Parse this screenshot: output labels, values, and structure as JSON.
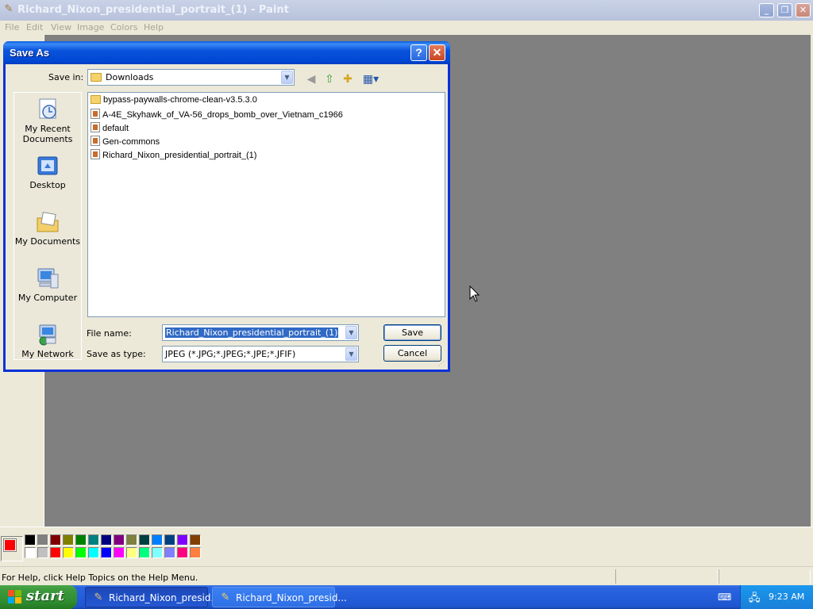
{
  "app": {
    "title": "Richard_Nixon_presidential_portrait_(1) - Paint",
    "menu": [
      "File",
      "Edit",
      "View",
      "Image",
      "Colors",
      "Help"
    ]
  },
  "dialog": {
    "title": "Save As",
    "save_in_label": "Save in:",
    "save_in_value": "Downloads",
    "places": [
      {
        "label": "My Recent Documents"
      },
      {
        "label": "Desktop"
      },
      {
        "label": "My Documents"
      },
      {
        "label": "My Computer"
      },
      {
        "label": "My Network"
      }
    ],
    "files": [
      {
        "name": "bypass-paywalls-chrome-clean-v3.5.3.0",
        "type": "folder"
      },
      {
        "name": "A-4E_Skyhawk_of_VA-56_drops_bomb_over_Vietnam_c1966",
        "type": "image"
      },
      {
        "name": "default",
        "type": "image"
      },
      {
        "name": "Gen-commons",
        "type": "image"
      },
      {
        "name": "Richard_Nixon_presidential_portrait_(1)",
        "type": "image"
      }
    ],
    "file_name_label": "File name:",
    "file_name_value": "Richard_Nixon_presidential_portrait_(1)",
    "save_type_label": "Save as type:",
    "save_type_value": "JPEG (*.JPG;*.JPEG;*.JPE;*.JFIF)",
    "save_button": "Save",
    "cancel_button": "Cancel"
  },
  "palette": {
    "foreground": "#ff0000",
    "background": "#ffffff",
    "row1": [
      "#000000",
      "#808080",
      "#800000",
      "#808000",
      "#008000",
      "#008080",
      "#000080",
      "#800080",
      "#808040",
      "#004040",
      "#0080ff",
      "#004080",
      "#8000ff",
      "#804000"
    ],
    "row2": [
      "#ffffff",
      "#c0c0c0",
      "#ff0000",
      "#ffff00",
      "#00ff00",
      "#00ffff",
      "#0000ff",
      "#ff00ff",
      "#ffff80",
      "#00ff80",
      "#80ffff",
      "#8080ff",
      "#ff0080",
      "#ff8040"
    ]
  },
  "status": {
    "message": "For Help, click Help Topics on the Help Menu."
  },
  "taskbar": {
    "start_label": "start",
    "tasks": [
      {
        "label": "Richard_Nixon_presid..."
      },
      {
        "label": "Richard_Nixon_presid..."
      }
    ],
    "clock": "9:23 AM"
  }
}
